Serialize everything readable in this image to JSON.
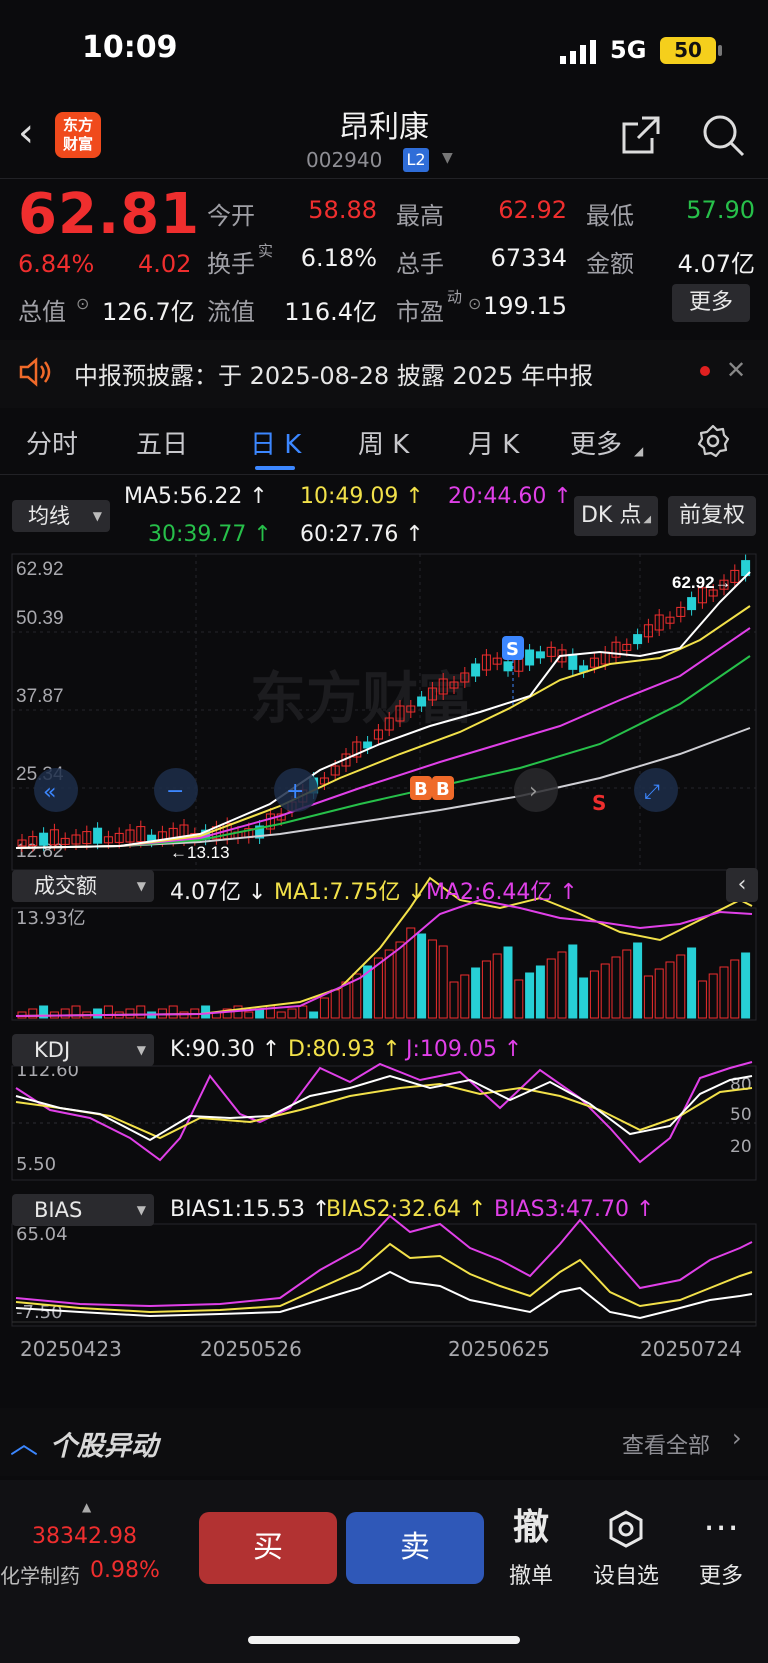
{
  "status_bar": {
    "time": "10:09",
    "network": "5G",
    "battery": "50"
  },
  "header": {
    "stock_name": "昂利康",
    "stock_code": "002940",
    "level_badge": "L2",
    "logo_text": "东方财富"
  },
  "quote": {
    "price": "62.81",
    "change_pct": "6.84%",
    "change": "4.02",
    "open_label": "今开",
    "open": "58.88",
    "high_label": "最高",
    "high": "62.92",
    "low_label": "最低",
    "low": "57.90",
    "turnover_label": "换手",
    "turnover_sup": "实",
    "turnover": "6.18%",
    "volume_label": "总手",
    "volume": "67334",
    "amount_label": "金额",
    "amount": "4.07亿",
    "market_cap_label": "总值",
    "market_cap": "126.7亿",
    "float_cap_label": "流值",
    "float_cap": "116.4亿",
    "pe_label": "市盈",
    "pe_sup": "动",
    "pe": "199.15",
    "more_label": "更多"
  },
  "notice": {
    "text": "中报预披露：于 2025-08-28 披露 2025 年中报"
  },
  "tabs": [
    {
      "label": "分时"
    },
    {
      "label": "五日"
    },
    {
      "label": "日 K"
    },
    {
      "label": "周 K"
    },
    {
      "label": "月 K"
    },
    {
      "label": "更多"
    }
  ],
  "active_tab": "日 K",
  "ma_row": {
    "dropdown": "均线",
    "ma5": "MA5:56.22 ↑",
    "ma10": "10:49.09 ↑",
    "ma20": "20:44.60 ↑",
    "ma30": "30:39.77 ↑",
    "ma60": "60:27.76 ↑",
    "dk_button": "DK 点",
    "adjust_button": "前复权"
  },
  "kline": {
    "axis_labels": [
      "62.92",
      "50.39",
      "37.87",
      "25.34",
      "12.82"
    ],
    "max_marker": "62.92→",
    "min_marker": "←13.13",
    "watermark": "东方财富"
  },
  "volume_panel": {
    "dropdown": "成交额",
    "value": "4.07亿 ↓",
    "ma1": "MA1:7.75亿 ↓",
    "ma2": "MA2:6.44亿 ↑",
    "top_label": "13.93亿"
  },
  "kdj_panel": {
    "dropdown": "KDJ",
    "k": "K:90.30 ↑",
    "d": "D:80.93 ↑",
    "j": "J:109.05 ↑",
    "top_label": "112.60",
    "bottom_label": "5.50",
    "levels": [
      "80",
      "50",
      "20"
    ]
  },
  "bias_panel": {
    "dropdown": "BIAS",
    "bias1": "BIAS1:15.53 ↑",
    "bias2": "BIAS2:32.64 ↑",
    "bias3": "BIAS3:47.70 ↑",
    "top_label": "65.04",
    "bottom_label": "-7.50"
  },
  "date_axis": [
    "20250423",
    "20250526",
    "20250625",
    "20250724"
  ],
  "news": {
    "title": "个股异动",
    "view_all": "查看全部"
  },
  "bottom_bar": {
    "index_value": "38342.98",
    "index_name": "化学制药",
    "index_pct": "0.98%",
    "buy": "买",
    "sell": "卖",
    "cancel_icon": "撤",
    "cancel": "撤单",
    "watchlist": "设自选",
    "more": "更多"
  },
  "colors": {
    "up": "#ef2e2e",
    "down": "#27c04a",
    "accent": "#3c87ff",
    "ma5": "#ffffff",
    "ma10": "#f2e14a",
    "ma20": "#e040e8",
    "ma30": "#27c04a",
    "ma60": "#cfcfd4"
  }
}
